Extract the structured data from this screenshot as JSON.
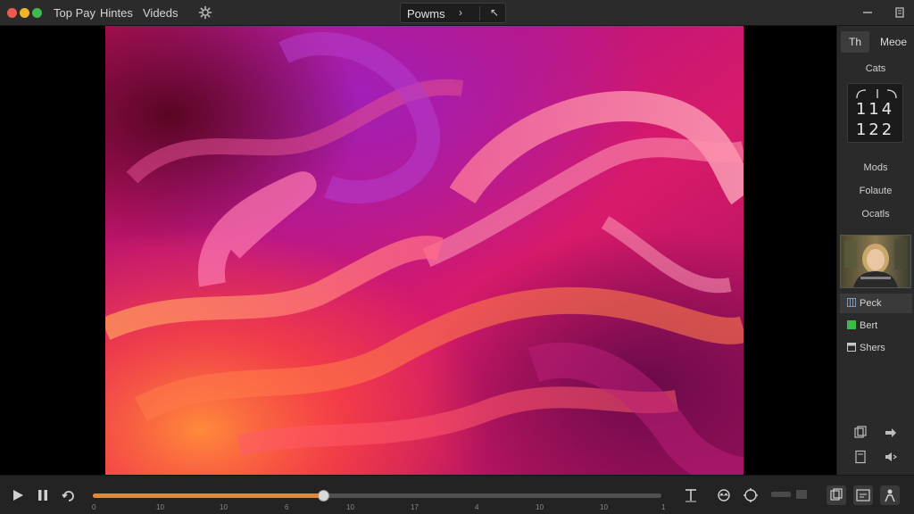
{
  "menu": {
    "items": [
      "Top Pay",
      "Hintes",
      "Videds"
    ]
  },
  "toolbar": {
    "tab_label": "Powms",
    "next_glyph": "›",
    "cursor_glyph": "↖"
  },
  "sidebar": {
    "tabs": [
      "Th",
      "Meoe"
    ],
    "cats_label": "Cats",
    "cat_rows": [
      "114",
      "122"
    ],
    "sections": [
      "Mods",
      "Folaute",
      "Ocatls"
    ],
    "items": [
      {
        "label": "Peck",
        "icon": "grid-icon",
        "color": "#7a9cc4"
      },
      {
        "label": "Bert",
        "icon": "square-icon",
        "color": "#3fba4a"
      },
      {
        "label": "Shers",
        "icon": "panel-icon",
        "color": "#c8c8c8"
      }
    ]
  },
  "player": {
    "progress_percent": 40.5,
    "tick_labels": [
      "0",
      "10",
      "10",
      "6",
      "10",
      "17",
      "4",
      "10",
      "10",
      "1"
    ]
  },
  "colors": {
    "accent": "#e8862e",
    "background": "#1e1e1e"
  }
}
